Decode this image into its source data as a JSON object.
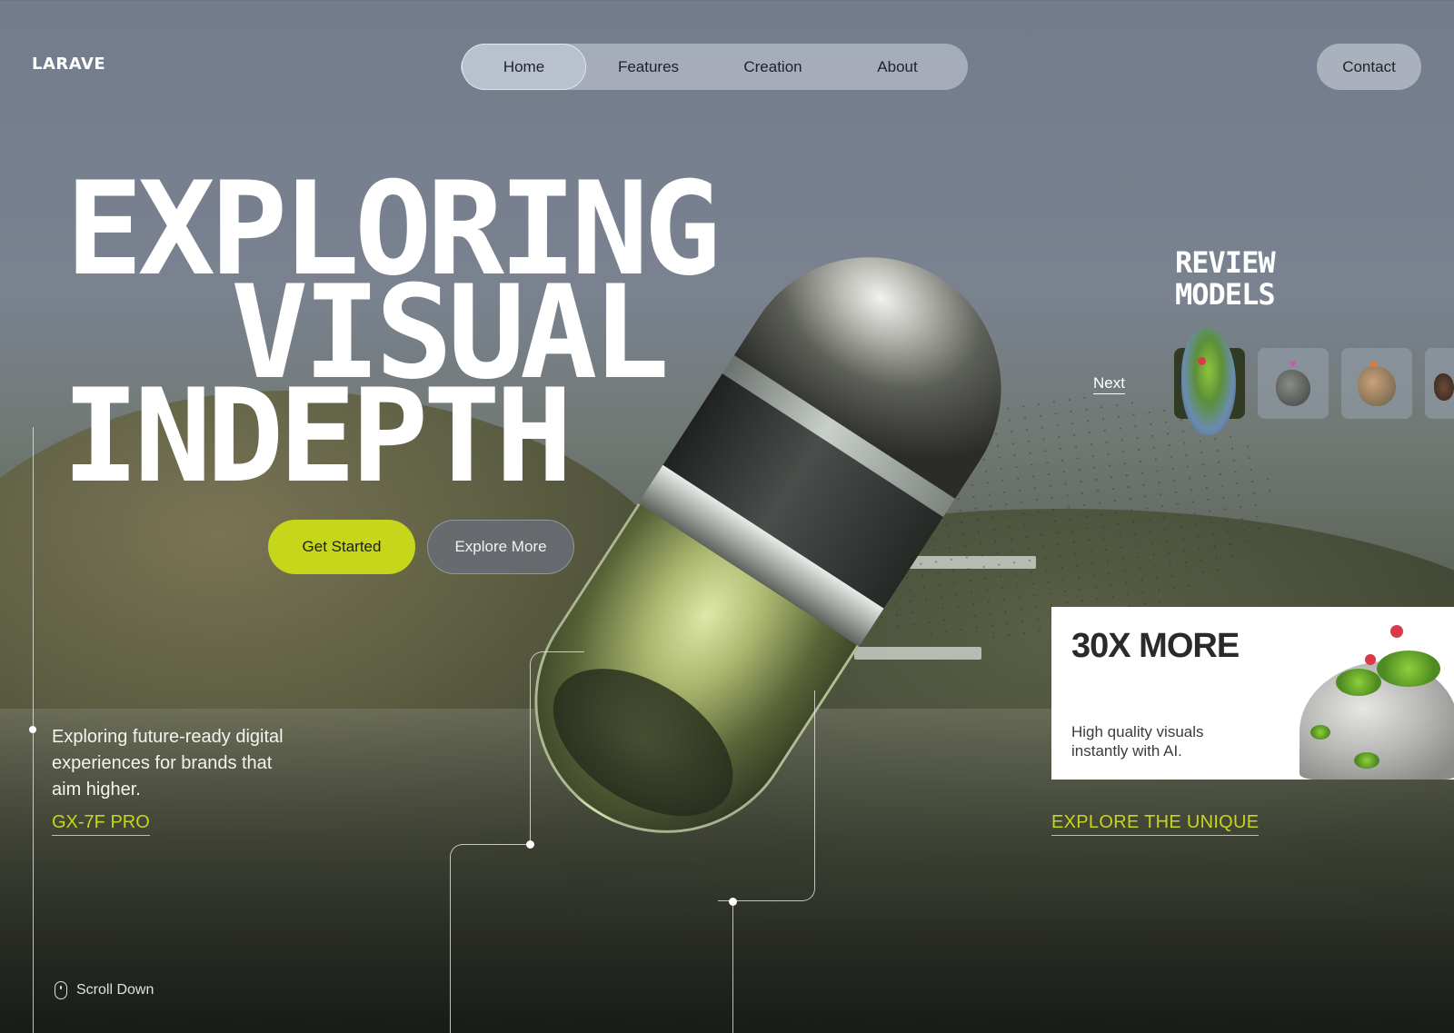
{
  "brand": {
    "logo": "LARAVE"
  },
  "nav": {
    "items": [
      {
        "label": "Home",
        "active": true
      },
      {
        "label": "Features",
        "active": false
      },
      {
        "label": "Creation",
        "active": false
      },
      {
        "label": "About",
        "active": false
      }
    ],
    "contact_label": "Contact"
  },
  "hero": {
    "line1": "EXPLORING",
    "line2": "VISUAL",
    "line3": "INDEPTH",
    "primary_button": "Get Started",
    "secondary_button": "Explore More"
  },
  "left_panel": {
    "lead": "Exploring future-ready digital experiences for brands that aim higher.",
    "link": "GX-7F PRO",
    "scroll_label": "Scroll Down"
  },
  "review": {
    "title_line1": "REVIEW",
    "title_line2": "MODELS",
    "next_label": "Next"
  },
  "promo": {
    "title": "30X MORE",
    "subtitle": "High quality visuals instantly with AI.",
    "link": "EXPLORE THE UNIQUE"
  },
  "colors": {
    "accent": "#c6d61b",
    "text_light": "#ffffff",
    "pill_bg": "#cdd4de"
  },
  "icons": [
    "mouse-icon"
  ]
}
